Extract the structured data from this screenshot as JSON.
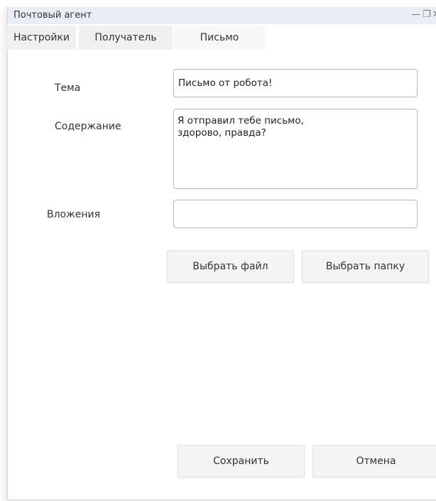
{
  "window": {
    "title": "Почтовый агент",
    "controls": {
      "minimize": "—",
      "restore": "❐",
      "close": "✕"
    }
  },
  "tabs": [
    {
      "label": "Настройки"
    },
    {
      "label": "Получатель"
    },
    {
      "label": "Письмо",
      "active": true
    }
  ],
  "form": {
    "subject_label": "Тема",
    "subject_value": "Письмо от робота!",
    "content_label": "Содержание",
    "content_value": "Я отправил тебе письмо,\nздорово, правда?",
    "attachments_label": "Вложения",
    "attachments_value": ""
  },
  "buttons": {
    "choose_file": "Выбрать файл",
    "choose_folder": "Выбрать папку",
    "save": "Сохранить",
    "cancel": "Отмена"
  },
  "colors": {
    "titlebar": "#e9eef4",
    "tab_background": "#f0f0f0",
    "field_border": "#b9b9b9",
    "button_background": "#f4f4f4"
  }
}
